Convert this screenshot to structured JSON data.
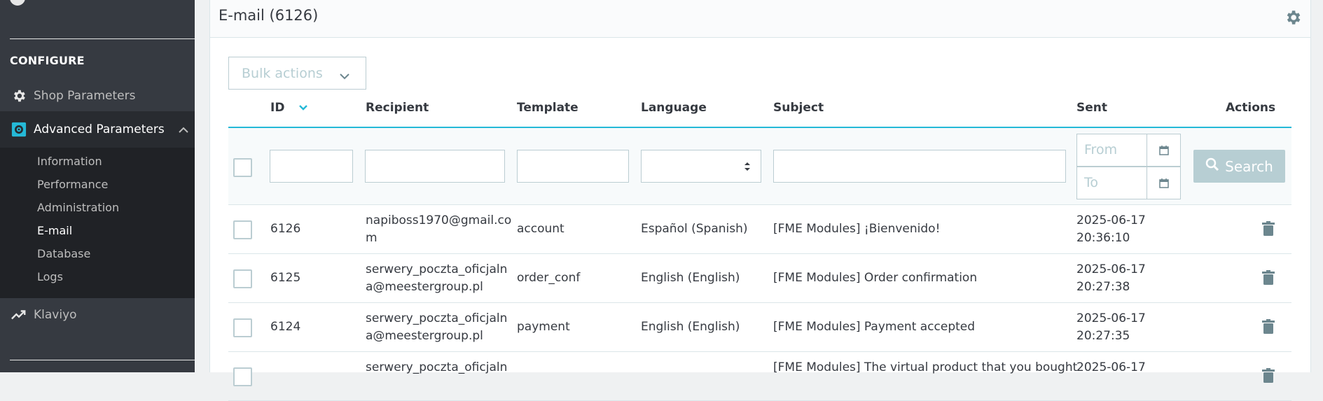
{
  "sidebar": {
    "section_title": "CONFIGURE",
    "shop_parameters": "Shop Parameters",
    "advanced_parameters": "Advanced Parameters",
    "subitems": [
      "Information",
      "Performance",
      "Administration",
      "E-mail",
      "Database",
      "Logs"
    ],
    "klaviyo": "Klaviyo"
  },
  "card": {
    "title": "E-mail (6126)"
  },
  "bulk": {
    "label": "Bulk actions"
  },
  "table": {
    "headers": {
      "id": "ID",
      "recipient": "Recipient",
      "template": "Template",
      "language": "Language",
      "subject": "Subject",
      "sent": "Sent",
      "actions": "Actions"
    },
    "filters": {
      "from_placeholder": "From",
      "to_placeholder": "To",
      "search_label": "Search"
    },
    "rows": [
      {
        "id": "6126",
        "recipient_l1": "napiboss1970@gmail.co",
        "recipient_l2": "m",
        "template": "account",
        "language": "Español (Spanish)",
        "subject_l1": "[FME Modules] ¡Bienvenido!",
        "subject_l2": "",
        "date": "2025-06-17",
        "time": "20:36:10"
      },
      {
        "id": "6125",
        "recipient_l1": "serwery_poczta_oficjaln",
        "recipient_l2": "a@meestergroup.pl",
        "template": "order_conf",
        "language": "English (English)",
        "subject_l1": "[FME Modules] Order confirmation",
        "subject_l2": "",
        "date": "2025-06-17",
        "time": "20:27:38"
      },
      {
        "id": "6124",
        "recipient_l1": "serwery_poczta_oficjaln",
        "recipient_l2": "a@meestergroup.pl",
        "template": "payment",
        "language": "English (English)",
        "subject_l1": "[FME Modules] Payment accepted",
        "subject_l2": "",
        "date": "2025-06-17",
        "time": "20:27:35"
      },
      {
        "id": "",
        "recipient_l1": "serwery_poczta_oficjaln",
        "recipient_l2": "",
        "template": "",
        "language": "",
        "subject_l1": "[FME Modules] The virtual product that you bought",
        "subject_l2": "",
        "date": "2025-06-17",
        "time": ""
      }
    ]
  },
  "colors": {
    "accent": "#25b9d7",
    "sidebar": "#363a41",
    "muted": "#b7ced3"
  }
}
